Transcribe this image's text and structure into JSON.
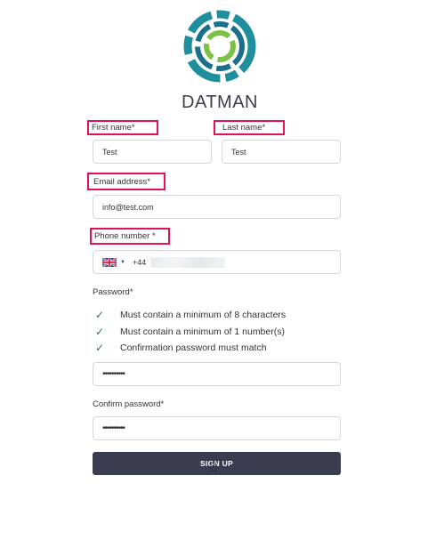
{
  "brand": {
    "name": "DATMAN"
  },
  "form": {
    "first_name": {
      "label": "First name*",
      "value": "Test"
    },
    "last_name": {
      "label": "Last name*",
      "value": "Test"
    },
    "email": {
      "label": "Email address*",
      "value": "info@test.com"
    },
    "phone": {
      "label": "Phone number *",
      "country": "UK",
      "code": "+44"
    },
    "password": {
      "label": "Password*",
      "value": "••••••••••"
    },
    "rules": [
      "Must contain a minimum of 8 characters",
      "Must contain a minimum of 1 number(s)",
      "Confirmation password must match"
    ],
    "confirm_password": {
      "label": "Confirm password*",
      "value": "••••••••••"
    },
    "submit_label": "SIGN UP"
  },
  "colors": {
    "highlight": "#e0105a",
    "button": "#3a3d50",
    "check": "#2e7d32",
    "logo_teal": "#1f8f9e",
    "logo_green": "#7cc242"
  }
}
